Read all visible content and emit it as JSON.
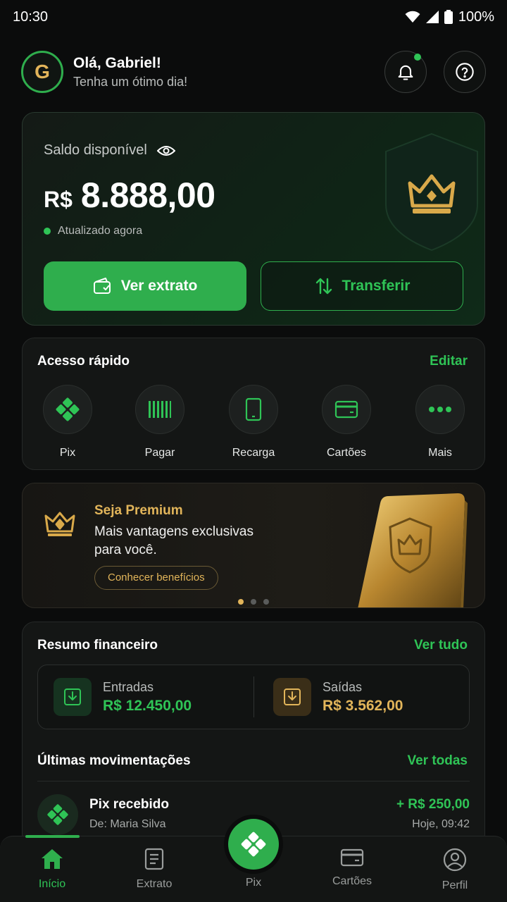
{
  "status": {
    "time": "10:30",
    "battery": "100%"
  },
  "header": {
    "avatar_letter": "G",
    "greeting": "Olá, Gabriel!",
    "subtitle": "Tenha um ótimo dia!"
  },
  "balance": {
    "label": "Saldo disponível",
    "currency": "R$",
    "value": "8.888,00",
    "updated": "Atualizado agora",
    "btn_statement": "Ver extrato",
    "btn_transfer": "Transferir"
  },
  "quick": {
    "title": "Acesso rápido",
    "edit": "Editar",
    "items": [
      {
        "label": "Pix",
        "icon": "pix-icon"
      },
      {
        "label": "Pagar",
        "icon": "barcode-icon"
      },
      {
        "label": "Recarga",
        "icon": "phone-icon"
      },
      {
        "label": "Cartões",
        "icon": "card-icon"
      },
      {
        "label": "Mais",
        "icon": "more-icon"
      }
    ]
  },
  "promo": {
    "title": "Seja Premium",
    "desc": "Mais vantagens exclusivas para você.",
    "cta": "Conhecer benefícios"
  },
  "summary": {
    "title": "Resumo financeiro",
    "see_all": "Ver tudo",
    "in_label": "Entradas",
    "in_value": "R$ 12.450,00",
    "out_label": "Saídas",
    "out_value": "R$ 3.562,00"
  },
  "transactions": {
    "title": "Últimas movimentações",
    "see_all": "Ver todas",
    "items": [
      {
        "title": "Pix recebido",
        "from": "De: Maria Silva",
        "amount": "+ R$ 250,00",
        "time": "Hoje, 09:42"
      }
    ]
  },
  "nav": {
    "home": "Início",
    "statement": "Extrato",
    "pix": "Pix",
    "cards": "Cartões",
    "profile": "Perfil"
  },
  "colors": {
    "accent": "#2fae4d",
    "gold": "#e2b55a",
    "background": "#0b0c0c"
  }
}
